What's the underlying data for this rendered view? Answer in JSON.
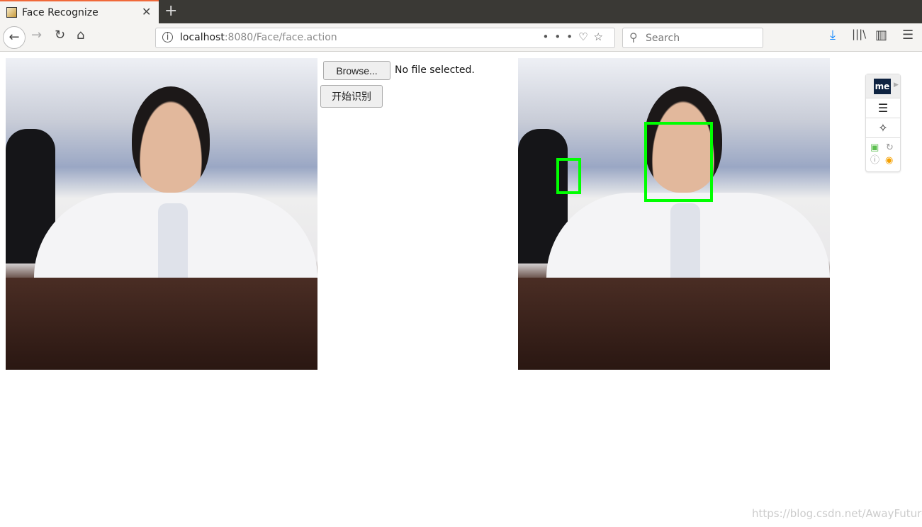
{
  "browser": {
    "tab_title": "Face Recognize",
    "url_host": "localhost",
    "url_path": ":8080/Face/face.action",
    "search_placeholder": "Search"
  },
  "page": {
    "browse_label": "Browse...",
    "no_file": "No file selected.",
    "recognize_label": "开始识别"
  },
  "detections": {
    "color": "#00ff00",
    "count": 2
  },
  "widget": {
    "logo": "me"
  },
  "watermark": "https://blog.csdn.net/AwayFuture"
}
